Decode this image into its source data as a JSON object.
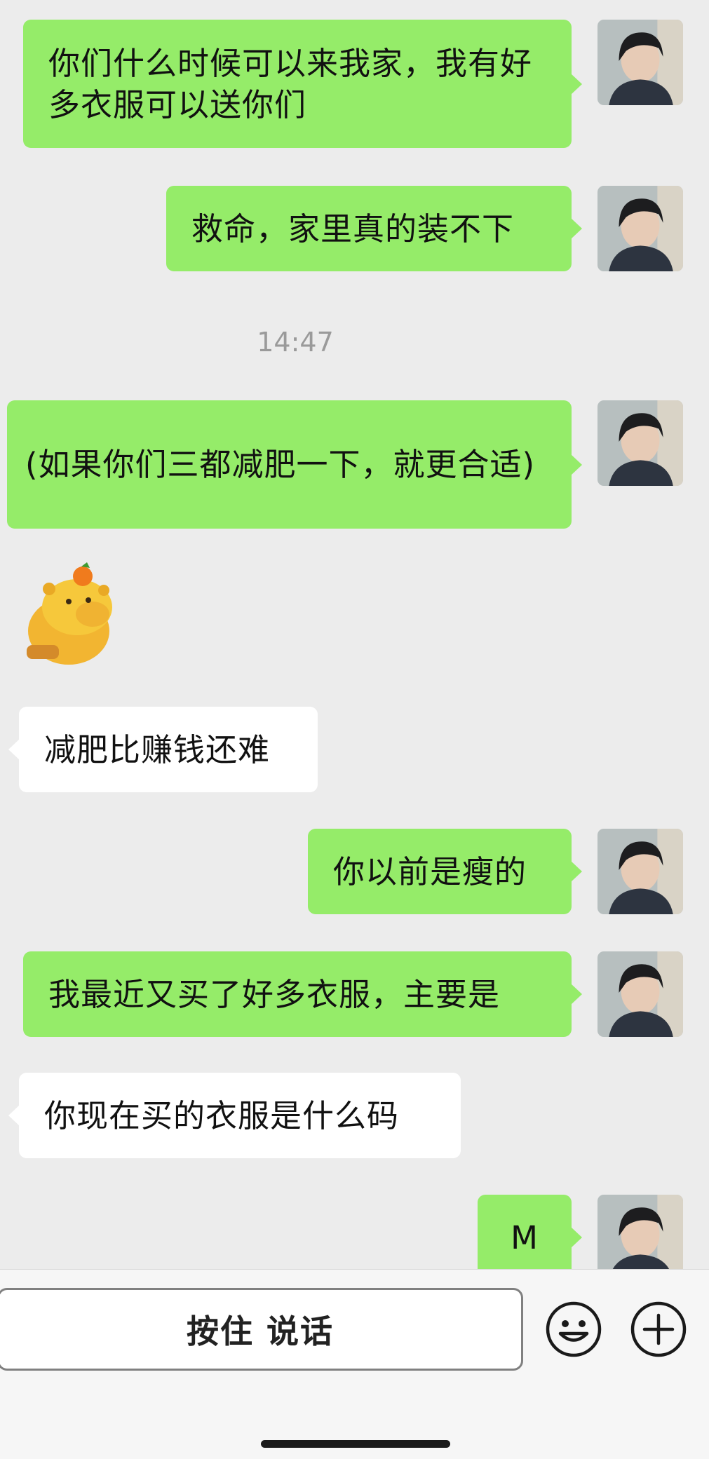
{
  "messages": [
    {
      "side": "me",
      "text": "你们什么时候可以来我家，我有好多衣服可以送你们"
    },
    {
      "side": "me",
      "text": "救命，家里真的装不下"
    },
    {
      "side": "me",
      "text": "(如果你们三都减肥一下，就更合适)"
    },
    {
      "side": "other",
      "text": "减肥比赚钱还难"
    },
    {
      "side": "me",
      "text": "你以前是瘦的"
    },
    {
      "side": "me",
      "text": "我最近又买了好多衣服，主要是"
    },
    {
      "side": "other",
      "text": "你现在买的衣服是什么码"
    },
    {
      "side": "me",
      "text": "M"
    }
  ],
  "timestamp": "14:47",
  "input_bar": {
    "voice_label": "按住 说话",
    "emoji_icon": "smiley-icon",
    "add_icon": "plus-circle-icon"
  },
  "colors": {
    "background": "#ececec",
    "my_bubble": "#95ec69",
    "other_bubble": "#ffffff"
  }
}
